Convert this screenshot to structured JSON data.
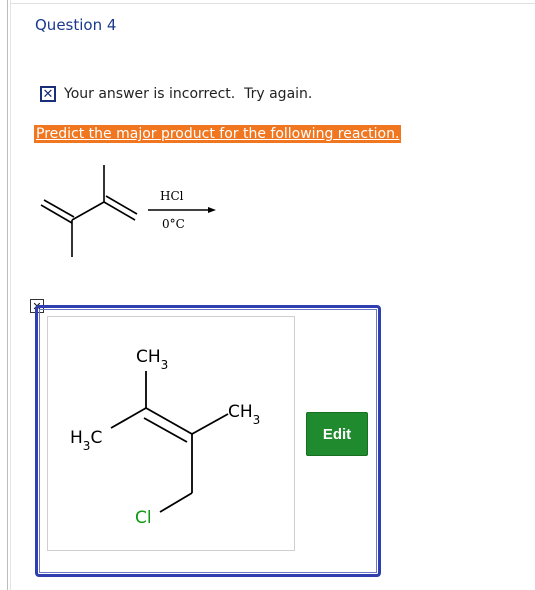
{
  "question": {
    "title": "Question 4"
  },
  "feedback": {
    "icon": "x-mark-icon",
    "message": "Your answer is incorrect.  Try again."
  },
  "prompt": {
    "text": "Predict the major product for the following reaction."
  },
  "reaction": {
    "reagent": "HCl",
    "condition": "0°C"
  },
  "answer": {
    "labels": {
      "ch3_top": "CH3",
      "ch3_right": "CH3",
      "h3c": "H3C",
      "cl": "Cl"
    },
    "edit_label": "Edit"
  },
  "colors": {
    "title": "#1a3a8f",
    "prompt_bg": "#f0761f",
    "edit_bg": "#1f8a2e",
    "frame": "#2f3fb0"
  }
}
